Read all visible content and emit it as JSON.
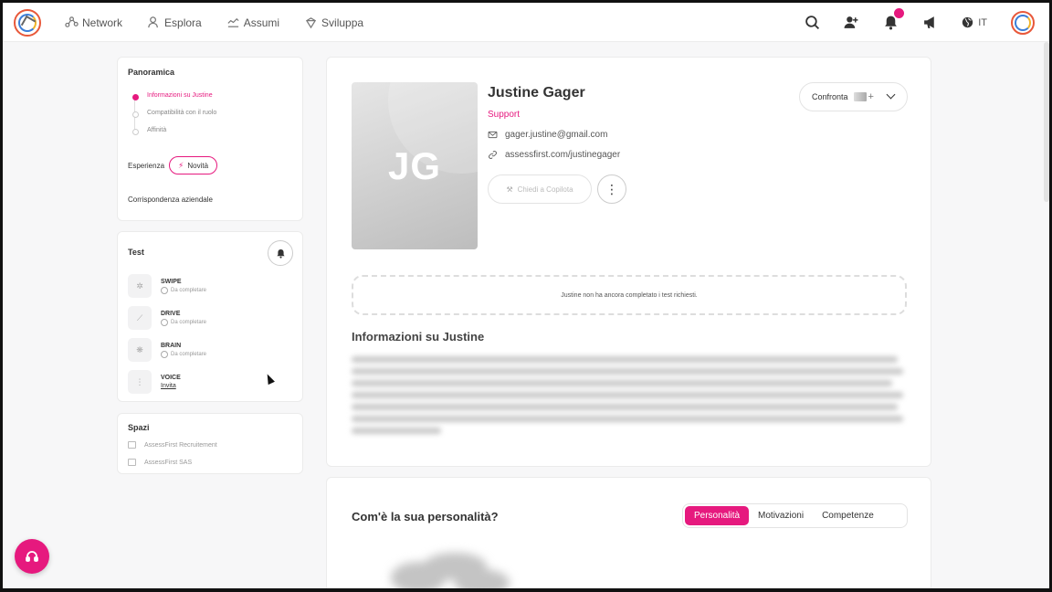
{
  "nav": {
    "items": [
      {
        "label": "Network",
        "icon": "network-icon"
      },
      {
        "label": "Esplora",
        "icon": "explore-icon"
      },
      {
        "label": "Assumi",
        "icon": "hire-icon"
      },
      {
        "label": "Sviluppa",
        "icon": "develop-icon"
      }
    ],
    "language": "IT",
    "accent_color": "#e6197e"
  },
  "overview": {
    "title": "Panoramica",
    "items": [
      "Informazioni su Justine",
      "Compatibilità con il ruolo",
      "Affinità"
    ],
    "active_index": 0,
    "experience_label": "Esperienza",
    "news_label": "Novità",
    "company_match": "Corrispondenza aziendale"
  },
  "tests": {
    "title": "Test",
    "items": [
      {
        "name": "SWIPE",
        "status": "Da completare"
      },
      {
        "name": "DRIVE",
        "status": "Da completare"
      },
      {
        "name": "BRAIN",
        "status": "Da completare"
      },
      {
        "name": "VOICE",
        "status": "Invita"
      }
    ]
  },
  "spaces": {
    "title": "Spazi",
    "items": [
      "AssessFirst Recruitement",
      "AssessFirst SAS"
    ]
  },
  "profile": {
    "initials": "JG",
    "name": "Justine Gager",
    "role": "Support",
    "email": "gager.justine@gmail.com",
    "link": "assessfirst.com/justinegager",
    "copilot_label": "Chiedi a Copilota",
    "compare_label": "Confronta",
    "notice": "Justine non ha ancora completato i test richiesti.",
    "about_title": "Informazioni su Justine"
  },
  "personality": {
    "title": "Com'è la sua personalità?",
    "tabs": [
      "Personalità",
      "Motivazioni",
      "Competenze"
    ],
    "active_tab": 0
  }
}
